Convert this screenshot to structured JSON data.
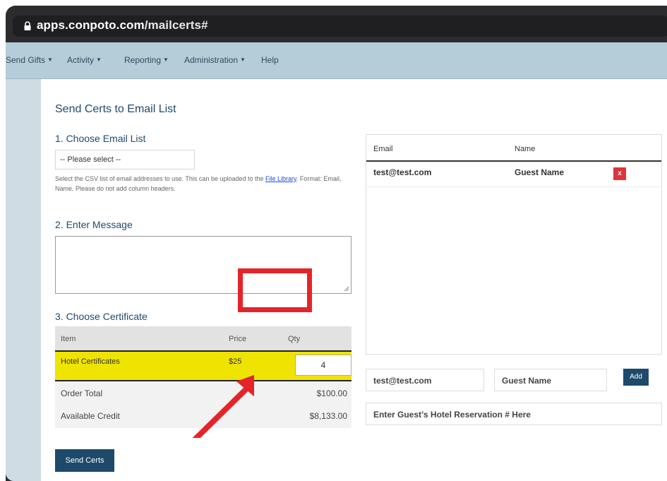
{
  "browser": {
    "url_host": "apps.conpoto.com",
    "url_path": "/mailcerts#"
  },
  "nav": {
    "items": [
      {
        "label": "Send Gifts",
        "has_caret": true
      },
      {
        "label": "Activity",
        "has_caret": true
      },
      {
        "label": "Reporting",
        "has_caret": true
      },
      {
        "label": "Administration",
        "has_caret": true
      },
      {
        "label": "Help",
        "has_caret": false
      }
    ]
  },
  "page": {
    "title": "Send Certs to Email List",
    "step1_title": "1. Choose Email List",
    "email_list_select_value": "-- Please select --",
    "help_text_before": "Select the CSV list of email addresses to use. This can be uploaded to the ",
    "help_text_link": "File Library",
    "help_text_after": ". Format: Email, Name. Please do not add column headers.",
    "step2_title": "2. Enter Message",
    "message_value": "",
    "step3_title": "3. Choose Certificate",
    "cert_table": {
      "headers": {
        "item": "Item",
        "price": "Price",
        "qty": "Qty"
      },
      "rows": [
        {
          "item": "Hotel Certificates",
          "price": "$25",
          "qty": "4"
        }
      ],
      "order_total_label": "Order Total",
      "order_total_value": "$100.00",
      "available_credit_label": "Available Credit",
      "available_credit_value": "$8,133.00"
    },
    "send_button": "Send Certs"
  },
  "email_panel": {
    "headers": {
      "email": "Email",
      "name": "Name"
    },
    "rows": [
      {
        "email": "test@test.com",
        "name": "Guest Name",
        "delete": "x"
      }
    ],
    "new_email_value": "test@test.com",
    "new_name_value": "Guest Name",
    "add_button": "Add",
    "reservation_placeholder": "Enter Guest’s Hotel Reservation # Here"
  },
  "annotation": {
    "highlight_color": "#e5242a",
    "highlight_color_yellow": "#efe400"
  }
}
